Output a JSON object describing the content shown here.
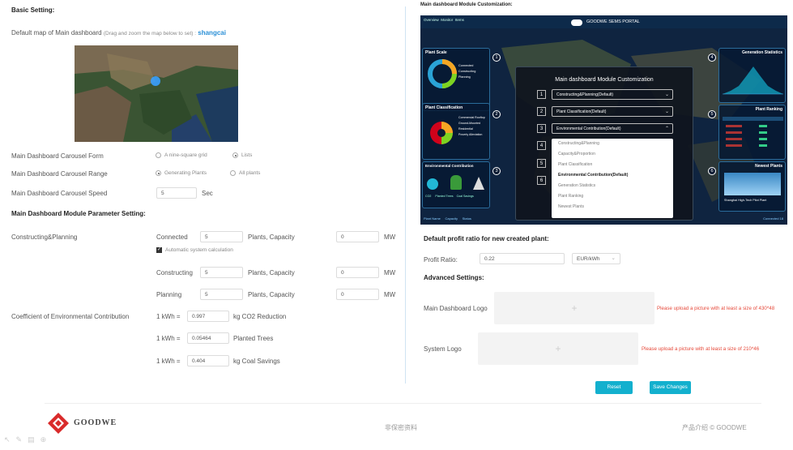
{
  "basic": {
    "title": "Basic Setting:",
    "map_label": "Default map of Main dashboard",
    "map_hint": "(Drag and zoom the map below to set) :",
    "map_city": "shangcai",
    "carousel_form_label": "Main Dashboard Carousel Form",
    "carousel_form_opt1": "A nine-square grid",
    "carousel_form_opt2": "Lists",
    "carousel_range_label": "Main Dashboard Carousel Range",
    "carousel_range_opt1": "Generating Plants",
    "carousel_range_opt2": "All plants",
    "carousel_speed_label": "Main Dashboard Carousel Speed",
    "carousel_speed_value": "5",
    "carousel_speed_unit": "Sec"
  },
  "module_param": {
    "title": "Main Dashboard Module Parameter Setting:",
    "constructing_label": "Constructing&Planning",
    "connected_label": "Connected",
    "connected_value": "5",
    "plants_capacity": "Plants, Capacity",
    "connected_mw": "0",
    "mw": "MW",
    "auto_calc": "Automatic system calculation",
    "constructing": "Constructing",
    "constructing_value": "5",
    "constructing_mw": "0",
    "planning": "Planning",
    "planning_value": "5",
    "planning_mw": "0",
    "coef_label": "Coefficient of Environmental Contribution",
    "kwh": "1 kWh =",
    "co2_value": "0.997",
    "co2_unit": "kg CO2 Reduction",
    "trees_value": "0.05464",
    "trees_unit": "Planted Trees",
    "coal_value": "0.404",
    "coal_unit": "kg Coal Savings"
  },
  "customization": {
    "title": "Main dashboard Module Customization:",
    "portal_title": "GOODWE SEMS PORTAL",
    "top_tabs": [
      "Overview",
      "Monitor",
      "Items"
    ],
    "panel_left1": "Plant Scale",
    "panel_left2": "Plant Classification",
    "panel_left3": "Environmental Contribution",
    "panel_right1": "Generation Statistics",
    "panel_right2": "Plant Ranking",
    "panel_right3": "Newest Plants",
    "scale_items": [
      "Connected",
      "Constructing",
      "Planning"
    ],
    "class_items": [
      "Commercial Rooftop",
      "Ground-Mounted",
      "Residential",
      "Poverty Alleviation"
    ],
    "env_items": [
      "CO2",
      "Planted Trees",
      "Coal Savings"
    ],
    "newest_caption": "Shanghai High-Tech Pilot Plant",
    "bottom_left": [
      "Plant Name",
      "Capacity",
      "Status"
    ],
    "bottom_right": "Connected 18",
    "modal_title": "Main dashboard Module Customization",
    "rows": [
      {
        "n": "1",
        "value": "Constructing&Planning(Default)"
      },
      {
        "n": "2",
        "value": "Plant Classification(Default)"
      },
      {
        "n": "3",
        "value": "Environmental Contribution(Default)"
      },
      {
        "n": "4",
        "value": ""
      },
      {
        "n": "5",
        "value": ""
      },
      {
        "n": "6",
        "value": ""
      }
    ],
    "dropdown": [
      "Constructing&Planning",
      "Capacity&Proportion",
      "Plant Classification",
      "Environmental Contribution(Default)",
      "Generation Statistics",
      "Plant Ranking",
      "Newest Plants"
    ],
    "badges": [
      "1",
      "2",
      "3",
      "4",
      "5",
      "6"
    ]
  },
  "profit": {
    "title": "Default profit ratio for new created plant:",
    "ratio_label": "Profit Ratio:",
    "ratio_value": "0.22",
    "currency": "EUR/kWh"
  },
  "advanced": {
    "title": "Advanced Settings:",
    "dash_logo": "Main Dashboard Logo",
    "dash_logo_warn": "Please upload a picture with at least a size of 430*48",
    "sys_logo": "System Logo",
    "sys_logo_warn": "Please upload a picture with at least a size of 210*46"
  },
  "buttons": {
    "reset": "Reset",
    "save": "Save Changes"
  },
  "footer": {
    "brand": "GOODWE",
    "center": "非保密资料",
    "right": "产品介绍 © GOODWE"
  },
  "colors": {
    "accent": "#13b0ce",
    "link": "#2a8fd6",
    "warn": "#e64a3b",
    "brand": "#d92b2b"
  }
}
